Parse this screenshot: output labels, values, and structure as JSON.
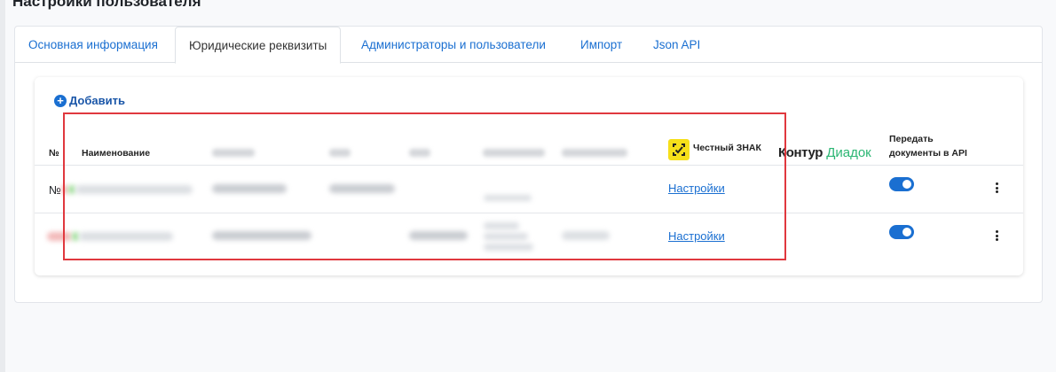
{
  "page": {
    "title": "Настройки пользователя"
  },
  "tabs": [
    {
      "label": "Основная информация",
      "active": false
    },
    {
      "label": "Юридические реквизиты",
      "active": true
    },
    {
      "label": "Администраторы и пользователи",
      "active": false
    },
    {
      "label": "Импорт",
      "active": false
    },
    {
      "label": "Json API",
      "active": false
    }
  ],
  "toolbar": {
    "add_label": "Добавить",
    "add_icon": "plus-circle-icon"
  },
  "table": {
    "headers": {
      "number": "№",
      "name": "Наименование",
      "chestny_znak": "Честный ЗНАК",
      "kontur": "Контур",
      "diadok": "Диадок",
      "api": "Передать документы в API"
    },
    "rows": [
      {
        "number": "№",
        "settings_label": "Настройки",
        "api_enabled": true
      },
      {
        "number": "",
        "settings_label": "Настройки",
        "api_enabled": true
      }
    ]
  },
  "colors": {
    "accent": "#1a6fd1",
    "chestny_znak_yellow": "#f6df1a",
    "diadok_green": "#2bb673",
    "highlight_frame": "#e0383e"
  }
}
